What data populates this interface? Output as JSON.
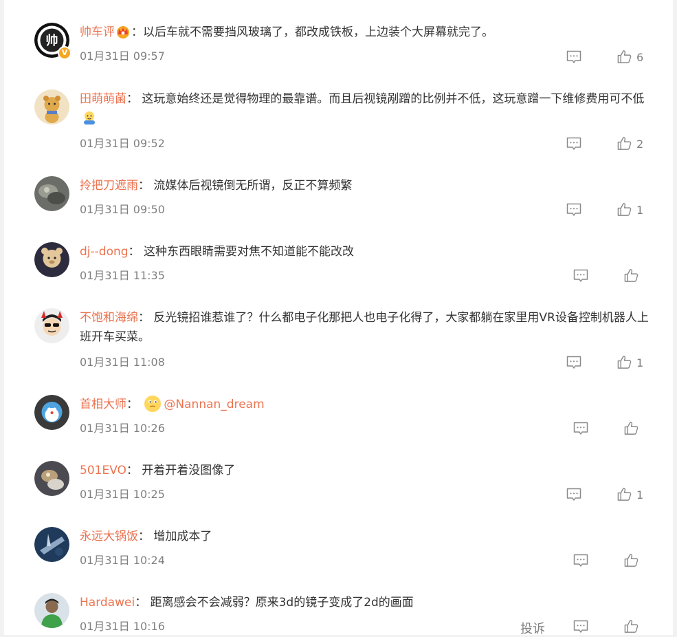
{
  "comments": [
    {
      "user": "帅车评",
      "text": "：以后车就不需要挡风玻璃了，都改成铁板，上边装个大屏幕就完了。",
      "time": "01月31日 09:57",
      "likes": "6"
    },
    {
      "user": "田萌萌菌",
      "text": "： 这玩意始终还是觉得物理的最靠谱。而且后视镜剐蹭的比例并不低，这玩意蹭一下维修费用可不低",
      "time": "01月31日 09:52",
      "likes": "2"
    },
    {
      "user": "拎把刀遮雨",
      "text": "： 流媒体后视镜倒无所谓，反正不算频繁",
      "time": "01月31日 09:50",
      "likes": "1"
    },
    {
      "user": "dj--dong",
      "text": "： 这种东西眼睛需要对焦不知道能不能改改",
      "time": "01月31日 11:35",
      "likes": ""
    },
    {
      "user": "不饱和海绵",
      "text": "： 反光镜招谁惹谁了？什么都电子化那把人也电子化得了，大家都躺在家里用VR设备控制机器人上班开车买菜。",
      "time": "01月31日 11:08",
      "likes": "1"
    },
    {
      "user": "首相大师",
      "text": "： ",
      "mention": "@Nannan_dream",
      "time": "01月31日 10:26",
      "likes": ""
    },
    {
      "user": "501EVO",
      "text": "： 开着开着没图像了",
      "time": "01月31日 10:25",
      "likes": "1"
    },
    {
      "user": "永远大锅饭",
      "text": "： 增加成本了",
      "time": "01月31日 10:24",
      "likes": ""
    },
    {
      "user": "Hardawei",
      "text": "： 距离感会不会减弱？原来3d的镜子变成了2d的画面",
      "time": "01月31日 10:16",
      "likes": ""
    }
  ],
  "report_label": "投诉",
  "colors": {
    "username": "#eb7350",
    "text": "#333333",
    "meta": "#808080"
  },
  "icons": {
    "reply": "comment-reply-icon",
    "like": "thumbs-up-icon",
    "verified": "verified-badge-icon"
  }
}
